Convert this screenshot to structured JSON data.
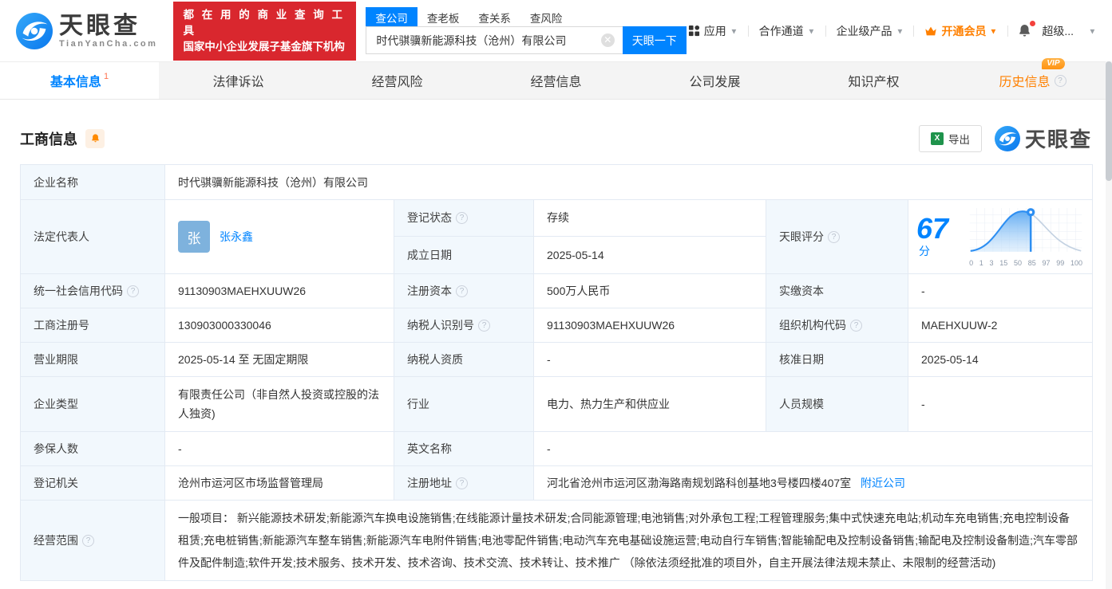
{
  "header": {
    "brand": {
      "name": "天眼查",
      "domain": "TianYanCha.com"
    },
    "slogan": {
      "line1": "都 在 用 的 商 业 查 询 工 具",
      "line2": "国家中小企业发展子基金旗下机构"
    },
    "search": {
      "tabs": [
        {
          "label": "查公司"
        },
        {
          "label": "查老板"
        },
        {
          "label": "查关系"
        },
        {
          "label": "查风险"
        }
      ],
      "value": "时代骐骥新能源科技（沧州）有限公司",
      "button": "天眼一下"
    },
    "nav": {
      "apps": "应用",
      "partner": "合作通道",
      "enterprise": "企业级产品",
      "vip": "开通会员",
      "user": "超级..."
    }
  },
  "tabs": {
    "basic": {
      "label": "基本信息",
      "badge": "1"
    },
    "legal": {
      "label": "法律诉讼"
    },
    "risk": {
      "label": "经营风险"
    },
    "operation": {
      "label": "经营信息"
    },
    "development": {
      "label": "公司发展"
    },
    "ip": {
      "label": "知识产权"
    },
    "history": {
      "label": "历史信息",
      "vip": "VIP"
    }
  },
  "section": {
    "title": "工商信息",
    "export": "导出",
    "brand": "天眼查"
  },
  "fields": {
    "company_name": {
      "label": "企业名称",
      "value": "时代骐骥新能源科技（沧州）有限公司"
    },
    "legal_rep": {
      "label": "法定代表人",
      "avatar": "张",
      "value": "张永鑫"
    },
    "reg_status": {
      "label": "登记状态",
      "value": "存续"
    },
    "establish_date": {
      "label": "成立日期",
      "value": "2025-05-14"
    },
    "score": {
      "label": "天眼评分",
      "value": "67",
      "unit": "分",
      "axis": [
        "0",
        "1",
        "3",
        "15",
        "50",
        "85",
        "97",
        "99",
        "100"
      ]
    },
    "credit_code": {
      "label": "统一社会信用代码",
      "value": "91130903MAEHXUUW26"
    },
    "reg_capital": {
      "label": "注册资本",
      "value": "500万人民币"
    },
    "paid_capital": {
      "label": "实缴资本",
      "value": "-"
    },
    "reg_number": {
      "label": "工商注册号",
      "value": "130903000330046"
    },
    "taxpayer_id": {
      "label": "纳税人识别号",
      "value": "91130903MAEHXUUW26"
    },
    "org_code": {
      "label": "组织机构代码",
      "value": "MAEHXUUW-2"
    },
    "business_term": {
      "label": "营业期限",
      "value": "2025-05-14 至 无固定期限"
    },
    "taxpayer_quality": {
      "label": "纳税人资质",
      "value": "-"
    },
    "approval_date": {
      "label": "核准日期",
      "value": "2025-05-14"
    },
    "company_type": {
      "label": "企业类型",
      "value": "有限责任公司（非自然人投资或控股的法人独资)"
    },
    "industry": {
      "label": "行业",
      "value": "电力、热力生产和供应业"
    },
    "staff_size": {
      "label": "人员规模",
      "value": "-"
    },
    "insured_count": {
      "label": "参保人数",
      "value": "-"
    },
    "english_name": {
      "label": "英文名称",
      "value": "-"
    },
    "reg_authority": {
      "label": "登记机关",
      "value": "沧州市运河区市场监督管理局"
    },
    "reg_address": {
      "label": "注册地址",
      "value": "河北省沧州市运河区渤海路南规划路科创基地3号楼四楼407室",
      "link": "附近公司"
    },
    "business_scope": {
      "label": "经营范围",
      "value": "一般项目： 新兴能源技术研发;新能源汽车换电设施销售;在线能源计量技术研发;合同能源管理;电池销售;对外承包工程;工程管理服务;集中式快速充电站;机动车充电销售;充电控制设备租赁;充电桩销售;新能源汽车整车销售;新能源汽车电附件销售;电池零配件销售;电动汽车充电基础设施运营;电动自行车销售;智能输配电及控制设备销售;输配电及控制设备制造;汽车零部件及配件制造;软件开发;技术服务、技术开发、技术咨询、技术交流、技术转让、技术推广 （除依法须经批准的项目外，自主开展法律法规未禁止、未限制的经营活动)"
    }
  },
  "colors": {
    "accent": "#0084ff",
    "brand_red": "#d9272e",
    "status_green": "#00b365",
    "vip_orange": "#ff8000"
  }
}
